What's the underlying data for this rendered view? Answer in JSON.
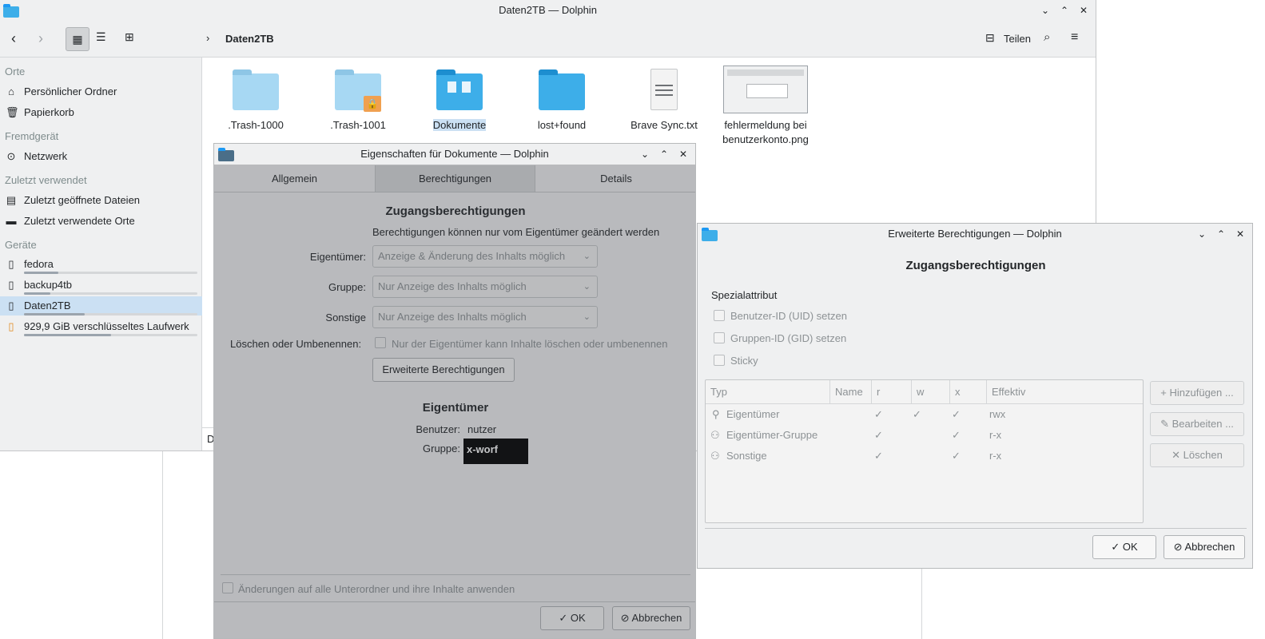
{
  "main": {
    "title": "Daten2TB — Dolphin",
    "breadcrumb": "Daten2TB",
    "share_label": "Teilen",
    "status_partial": "D",
    "sidebar": {
      "places_header": "Orte",
      "home": "Persönlicher Ordner",
      "trash": "Papierkorb",
      "remote_header": "Fremdgerät",
      "network": "Netzwerk",
      "recent_header": "Zuletzt verwendet",
      "recent_files": "Zuletzt geöffnete Dateien",
      "recent_places": "Zuletzt verwendete Orte",
      "devices_header": "Geräte",
      "devices": [
        {
          "label": "fedora",
          "usage": 0.2
        },
        {
          "label": "backup4tb",
          "usage": 0.15
        },
        {
          "label": "Daten2TB",
          "usage": 0.35
        },
        {
          "label": "929,9 GiB verschlüsseltes Laufwerk",
          "usage": 0.5
        }
      ]
    },
    "files": [
      {
        "name": ".Trash-1000"
      },
      {
        "name": ".Trash-1001"
      },
      {
        "name": "Dokumente"
      },
      {
        "name": "lost+found"
      },
      {
        "name": "Brave Sync.txt"
      },
      {
        "name": "fehlermeldung bei benutzerkonto.png"
      }
    ]
  },
  "props": {
    "title": "Eigenschaften für Dokumente — Dolphin",
    "tabs": [
      "Allgemein",
      "Berechtigungen",
      "Details"
    ],
    "section_access": "Zugangsberechtigungen",
    "note": "Berechtigungen können nur vom Eigentümer geändert werden",
    "owner_label": "Eigentümer:",
    "owner_value": "Anzeige & Änderung des Inhalts möglich",
    "group_label": "Gruppe:",
    "group_value": "Nur Anzeige des Inhalts möglich",
    "others_label": "Sonstige",
    "others_value": "Nur Anzeige des Inhalts möglich",
    "delete_label": "Löschen oder Umbenennen:",
    "delete_check": "Nur der Eigentümer kann Inhalte löschen oder umbenennen",
    "advanced_button": "Erweiterte Berechtigungen",
    "section_owner": "Eigentümer",
    "user_label": "Benutzer:",
    "user_value": "nutzer",
    "group_owner_label": "Gruppe:",
    "group_owner_value": "x-worf",
    "apply_recursive": "Änderungen auf alle Unterordner und ihre Inhalte anwenden",
    "ok": "OK",
    "cancel": "Abbrechen"
  },
  "adv": {
    "title": "Erweiterte Berechtigungen — Dolphin",
    "heading": "Zugangsberechtigungen",
    "special_header": "Spezialattribut",
    "uid": "Benutzer-ID (UID) setzen",
    "gid": "Gruppen-ID (GID) setzen",
    "sticky": "Sticky",
    "columns": [
      "Typ",
      "Name",
      "r",
      "w",
      "x",
      "Effektiv"
    ],
    "rows": [
      {
        "type": "Eigentümer",
        "r": "✓",
        "w": "✓",
        "x": "✓",
        "eff": "rwx"
      },
      {
        "type": "Eigentümer-Gruppe",
        "r": "✓",
        "w": "",
        "x": "✓",
        "eff": "r-x"
      },
      {
        "type": "Sonstige",
        "r": "✓",
        "w": "",
        "x": "✓",
        "eff": "r-x"
      }
    ],
    "add": "Hinzufügen ...",
    "edit": "Bearbeiten ...",
    "delete": "Löschen",
    "ok": "OK",
    "cancel": "Abbrechen"
  },
  "icons": {
    "accent": "#3daee9",
    "selection": "#cbe0f3"
  }
}
